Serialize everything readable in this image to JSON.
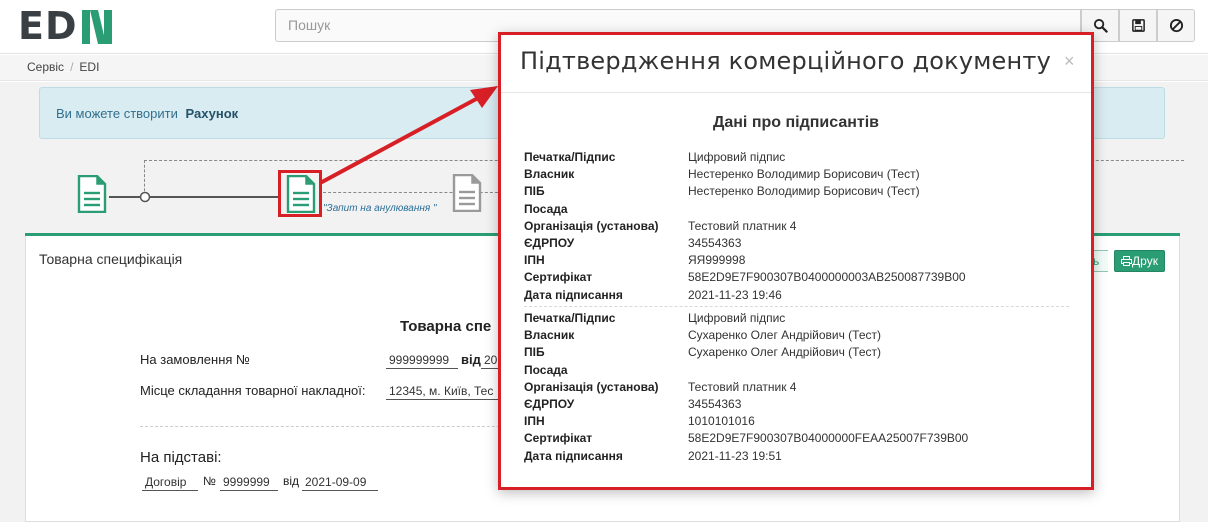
{
  "header": {
    "logo_text": "ED",
    "search_placeholder": "Пошук",
    "buttons": [
      "search-icon",
      "save-icon",
      "cancel-icon"
    ]
  },
  "breadcrumb": {
    "items": [
      "Сервіс",
      "EDI"
    ],
    "separator": "/"
  },
  "alert": {
    "text": "Ви можете створити",
    "link": "Рахунок"
  },
  "flow": {
    "step_label": "\"Запит на анулювання \""
  },
  "panel": {
    "title": "Товарна специфікація",
    "btn_partial": "ь",
    "btn_print": "Друк",
    "doc_heading": "Товарна спе",
    "order_label": "На замовлення №",
    "order_no": "999999999",
    "order_from_label": "від",
    "order_from_val": "20",
    "place_label": "Місце складання товарної накладної:",
    "place_val": "12345, м. Київ, Тес",
    "basis_heading": "На підставі:",
    "basis_doc": "Договір",
    "basis_no_label": "№",
    "basis_no": "9999999",
    "basis_from_label": "від",
    "basis_date": "2021-09-09"
  },
  "modal": {
    "title": "Підтвердження комерційного документу",
    "close": "×",
    "subtitle": "Дані про підписантів",
    "signers": [
      {
        "rows": [
          {
            "k": "Печатка/Підпис",
            "v": "Цифровий підпис"
          },
          {
            "k": "Власник",
            "v": "Нестеренко Володимир Борисович (Тест)"
          },
          {
            "k": "ПІБ",
            "v": "Нестеренко Володимир Борисович (Тест)"
          },
          {
            "k": "Посада",
            "v": ""
          },
          {
            "k": "Організація (установа)",
            "v": "Тестовий платник 4"
          },
          {
            "k": "ЄДРПОУ",
            "v": "34554363"
          },
          {
            "k": "ІПН",
            "v": "ЯЯ999998"
          },
          {
            "k": "Сертифікат",
            "v": "58E2D9E7F900307B0400000003AB250087739B00"
          },
          {
            "k": "Дата підписання",
            "v": "2021-11-23 19:46"
          }
        ]
      },
      {
        "rows": [
          {
            "k": "Печатка/Підпис",
            "v": "Цифровий підпис"
          },
          {
            "k": "Власник",
            "v": "Сухаренко Олег Андрійович (Тест)"
          },
          {
            "k": "ПІБ",
            "v": "Сухаренко Олег Андрійович (Тест)"
          },
          {
            "k": "Посада",
            "v": ""
          },
          {
            "k": "Організація (установа)",
            "v": "Тестовий платник 4"
          },
          {
            "k": "ЄДРПОУ",
            "v": "34554363"
          },
          {
            "k": "ІПН",
            "v": "1010101016"
          },
          {
            "k": "Сертифікат",
            "v": "58E2D9E7F900307B04000000FEAA25007F739B00"
          },
          {
            "k": "Дата підписання",
            "v": "2021-11-23 19:51"
          }
        ]
      }
    ]
  },
  "colors": {
    "brand_green": "#2a9d74",
    "highlight_red": "#d81f26",
    "alert_bg": "#d9ecf1"
  }
}
